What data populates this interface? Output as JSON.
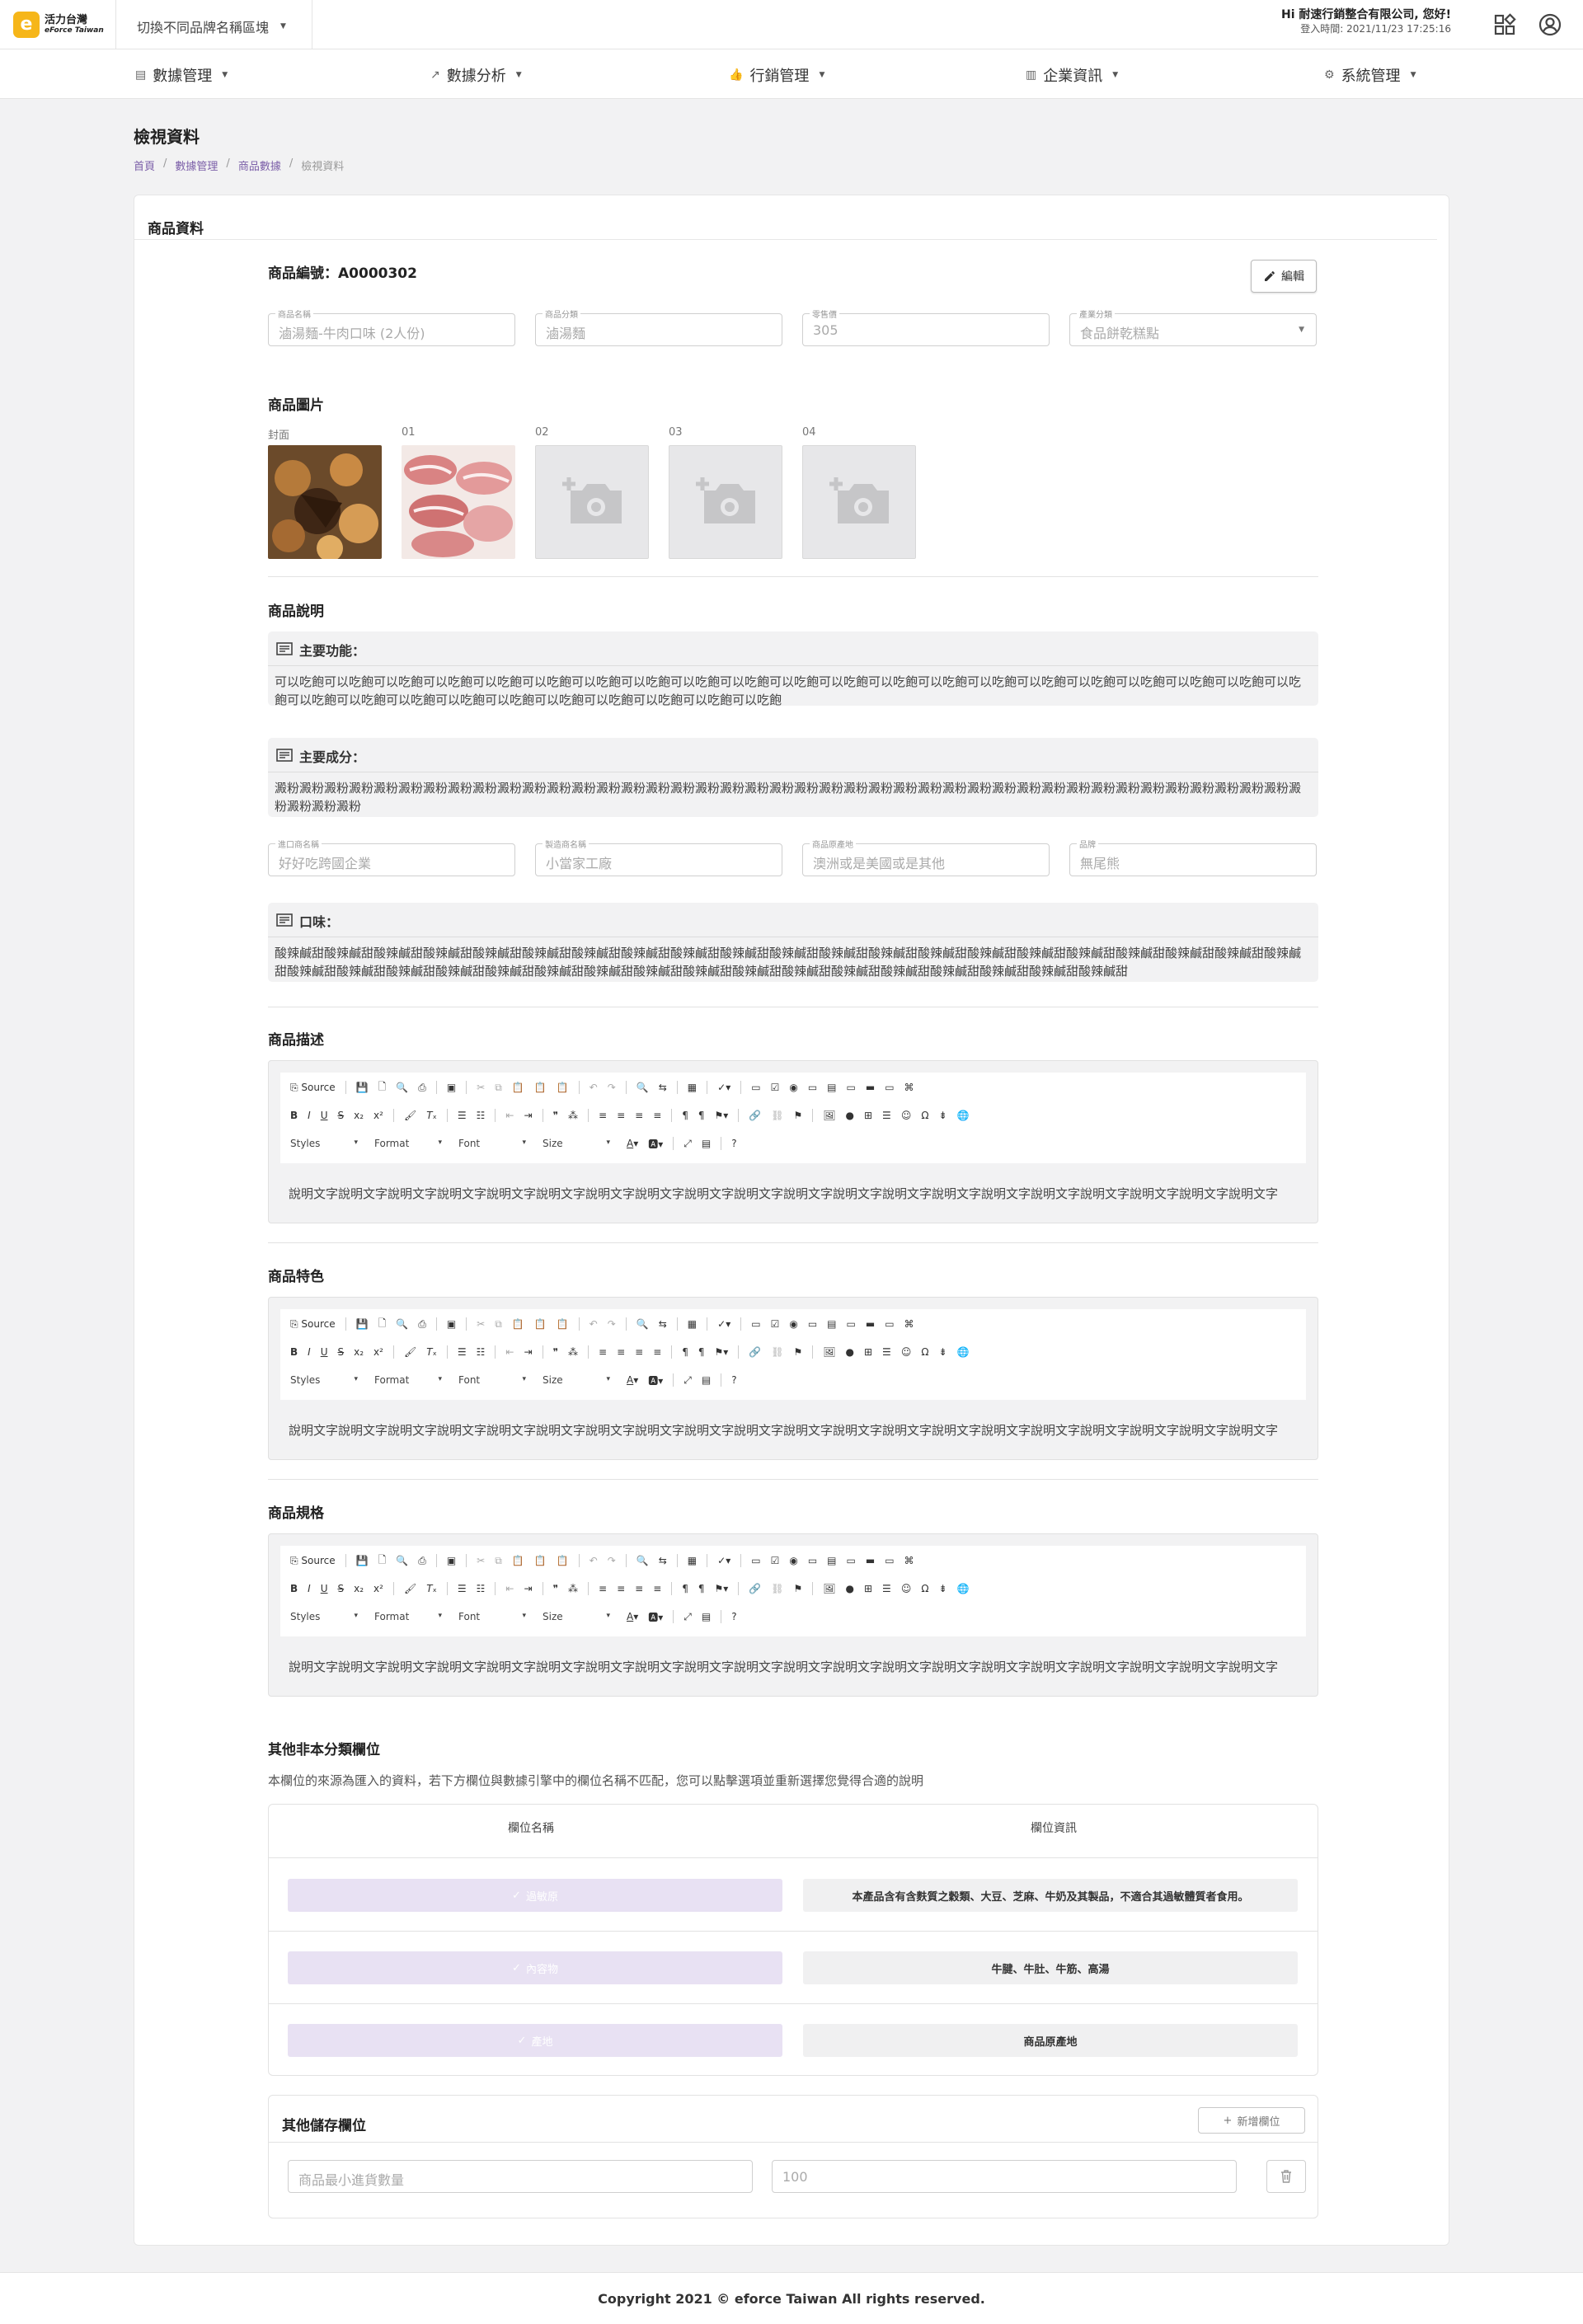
{
  "header": {
    "logo_cn": "活力台灣",
    "logo_en": "eForce Taiwan",
    "brand_switch": "切換不同品牌名稱區塊",
    "greeting": "Hi 耐速行銷整合有限公司, 您好!",
    "login_time": "登入時間: 2021/11/23 17:25:16"
  },
  "nav": {
    "items": [
      {
        "label": "數據管理",
        "icon": "database-icon"
      },
      {
        "label": "數據分析",
        "icon": "chart-line-icon"
      },
      {
        "label": "行銷管理",
        "icon": "thumbs-up-icon"
      },
      {
        "label": "企業資訊",
        "icon": "building-icon"
      },
      {
        "label": "系統管理",
        "icon": "gear-icon"
      }
    ]
  },
  "page": {
    "title": "檢視資料",
    "breadcrumb": [
      "首頁",
      "數據管理",
      "商品數據",
      "檢視資料"
    ],
    "sep": "/"
  },
  "card": {
    "title": "商品資料",
    "product_id": "商品編號：A0000302",
    "edit_label": "編輯",
    "fields": [
      {
        "label": "商品名稱",
        "value": "滷湯麵-牛肉口味 (2人份)"
      },
      {
        "label": "商品分類",
        "value": "滷湯麵"
      },
      {
        "label": "零售價",
        "value": "305"
      },
      {
        "label": "產業分類",
        "value": "食品餅乾糕點"
      }
    ],
    "images": {
      "title": "商品圖片",
      "labels": [
        "封面",
        "01",
        "02",
        "03",
        "04"
      ]
    },
    "description": {
      "title": "商品說明",
      "features": {
        "label": "主要功能：",
        "text": "可以吃飽可以吃飽可以吃飽可以吃飽可以吃飽可以吃飽可以吃飽可以吃飽可以吃飽可以吃飽可以吃飽可以吃飽可以吃飽可以吃飽可以吃飽可以吃飽可以吃飽可以吃飽可以吃飽可以吃飽可以吃飽可以吃飽可以吃飽可以吃飽可以吃飽可以吃飽可以吃飽可以吃飽可以吃飽可以吃飽可以吃飽"
      },
      "ingredients": {
        "label": "主要成分：",
        "text": "澱粉澱粉澱粉澱粉澱粉澱粉澱粉澱粉澱粉澱粉澱粉澱粉澱粉澱粉澱粉澱粉澱粉澱粉澱粉澱粉澱粉澱粉澱粉澱粉澱粉澱粉澱粉澱粉澱粉澱粉澱粉澱粉澱粉澱粉澱粉澱粉澱粉澱粉澱粉澱粉澱粉澱粉澱粉澱粉澱粉"
      },
      "fields2": [
        {
          "label": "進口商名稱",
          "value": "好好吃跨國企業"
        },
        {
          "label": "製造商名稱",
          "value": "小當家工廠"
        },
        {
          "label": "商品原產地",
          "value": "澳洲或是美國或是其他"
        },
        {
          "label": "品牌",
          "value": "無尾熊"
        }
      ],
      "taste": {
        "label": "口味：",
        "text": "酸辣鹹甜酸辣鹹甜酸辣鹹甜酸辣鹹甜酸辣鹹甜酸辣鹹甜酸辣鹹甜酸辣鹹甜酸辣鹹甜酸辣鹹甜酸辣鹹甜酸辣鹹甜酸辣鹹甜酸辣鹹甜酸辣鹹甜酸辣鹹甜酸辣鹹甜酸辣鹹甜酸辣鹹甜酸辣鹹甜酸辣鹹甜酸辣鹹甜酸辣鹹甜酸辣鹹甜酸辣鹹甜酸辣鹹甜酸辣鹹甜酸辣鹹甜酸辣鹹甜酸辣鹹甜酸辣鹹甜酸辣鹹甜酸辣鹹甜酸辣鹹甜酸辣鹹甜酸辣鹹甜酸辣鹹甜酸辣鹹甜"
      }
    },
    "editors": [
      {
        "title": "商品描述",
        "content": "說明文字說明文字說明文字說明文字說明文字說明文字說明文字說明文字說明文字說明文字說明文字說明文字說明文字說明文字說明文字說明文字說明文字說明文字說明文字說明文字"
      },
      {
        "title": "商品特色",
        "content": "說明文字說明文字說明文字說明文字說明文字說明文字說明文字說明文字說明文字說明文字說明文字說明文字說明文字說明文字說明文字說明文字說明文字說明文字說明文字說明文字"
      },
      {
        "title": "商品規格",
        "content": "說明文字說明文字說明文字說明文字說明文字說明文字說明文字說明文字說明文字說明文字說明文字說明文字說明文字說明文字說明文字說明文字說明文字說明文字說明文字說明文字"
      }
    ],
    "editor_toolbar": {
      "source": "Source",
      "styles": "Styles",
      "format": "Format",
      "font": "Font",
      "size": "Size"
    },
    "unclassified": {
      "title": "其他非本分類欄位",
      "desc": "本欄位的來源為匯入的資料，若下方欄位與數據引擎中的欄位名稱不匹配，您可以點擊選項並重新選擇您覺得合適的說明",
      "col_name": "欄位名稱",
      "col_info": "欄位資訊",
      "rows": [
        {
          "name": "過敏原",
          "info": "本產品含有含麩質之穀類、大豆、芝麻、牛奶及其製品，不適合其過敏體質者食用。"
        },
        {
          "name": "內容物",
          "info": "牛腱、牛肚、牛筋、高湯"
        },
        {
          "name": "產地",
          "info": "商品原產地"
        }
      ]
    },
    "other_storage": {
      "title": "其他儲存欄位",
      "add_label": "新增欄位",
      "field_name": "商品最小進貨數量",
      "field_value": "100"
    }
  },
  "footer": {
    "text": "Copyright 2021 © eforce Taiwan All rights reserved."
  },
  "colors": {
    "accent": "#7b5ea8",
    "pill": "#e8e1f3",
    "logo": "#f6b619"
  }
}
